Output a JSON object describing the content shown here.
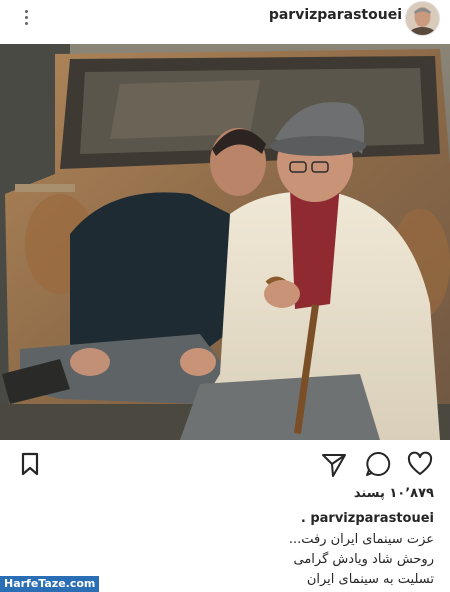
{
  "header": {
    "username": "parvizparastouei",
    "more_icon": "more-vertical-icon"
  },
  "post": {
    "likes": "۱۰٬۸۷۹ پسند",
    "caption_username": "parvizparastouei .",
    "caption_lines": [
      "عزت سینمای ایران رفت...",
      "روحش شاد ویادش گرامی",
      "تسلیت به سینمای ایران"
    ]
  },
  "actions": {
    "bookmark_icon": "bookmark-icon",
    "share_icon": "send-icon",
    "comment_icon": "comment-icon",
    "like_icon": "heart-icon"
  },
  "watermark": {
    "text": "HarfeTaze.com"
  }
}
